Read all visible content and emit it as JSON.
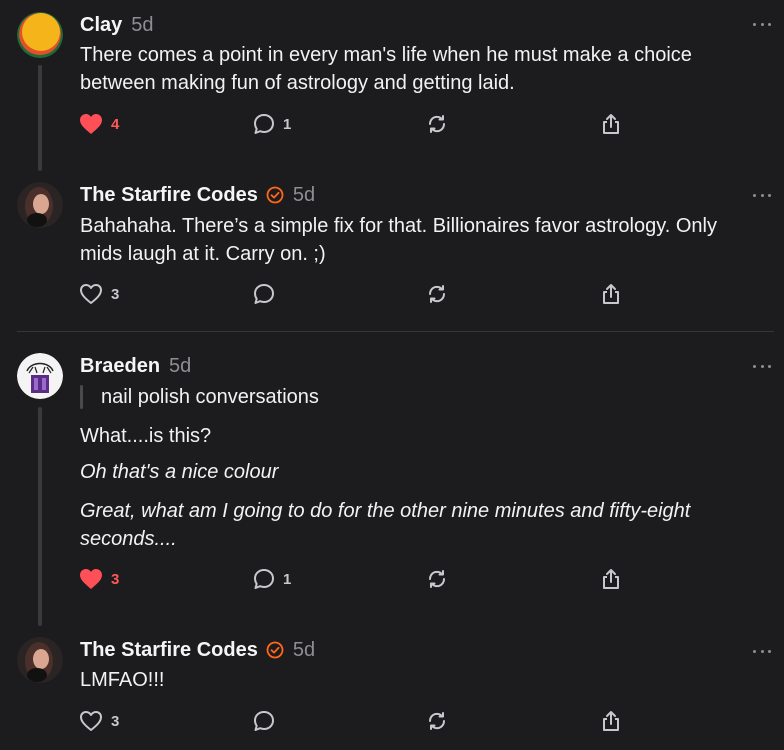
{
  "posts": [
    {
      "name": "Clay",
      "time": "5d",
      "verified": false,
      "text": "There comes a point in every man's life when he must make a choice between making fun of astrology and getting laid.",
      "likes": "4",
      "liked": true,
      "replies": "1"
    },
    {
      "name": "The Starfire Codes",
      "time": "5d",
      "verified": true,
      "text": "Bahahaha. There’s a simple fix for that. Billionaires favor astrology. Only mids laugh at it. Carry on. ;)",
      "likes": "3",
      "liked": false,
      "replies": ""
    },
    {
      "name": "Braeden",
      "time": "5d",
      "verified": false,
      "quote": "nail polish conversations",
      "line1": "What....is this?",
      "line2": "Oh that's a nice colour",
      "line3": "Great, what am I going to do for the other nine minutes and fifty-eight seconds....",
      "likes": "3",
      "liked": true,
      "replies": "1"
    },
    {
      "name": "The Starfire Codes",
      "time": "5d",
      "verified": true,
      "text": "LMFAO!!!",
      "likes": "3",
      "liked": false,
      "replies": ""
    }
  ],
  "icons": {
    "like": "heart-icon",
    "reply": "comment-icon",
    "repost": "repost-icon",
    "share": "share-icon",
    "more": "more-icon",
    "verified": "verified-icon"
  },
  "colors": {
    "background": "#1c1c1e",
    "like_red": "#ff4f57",
    "verified_orange": "#ff6719"
  }
}
